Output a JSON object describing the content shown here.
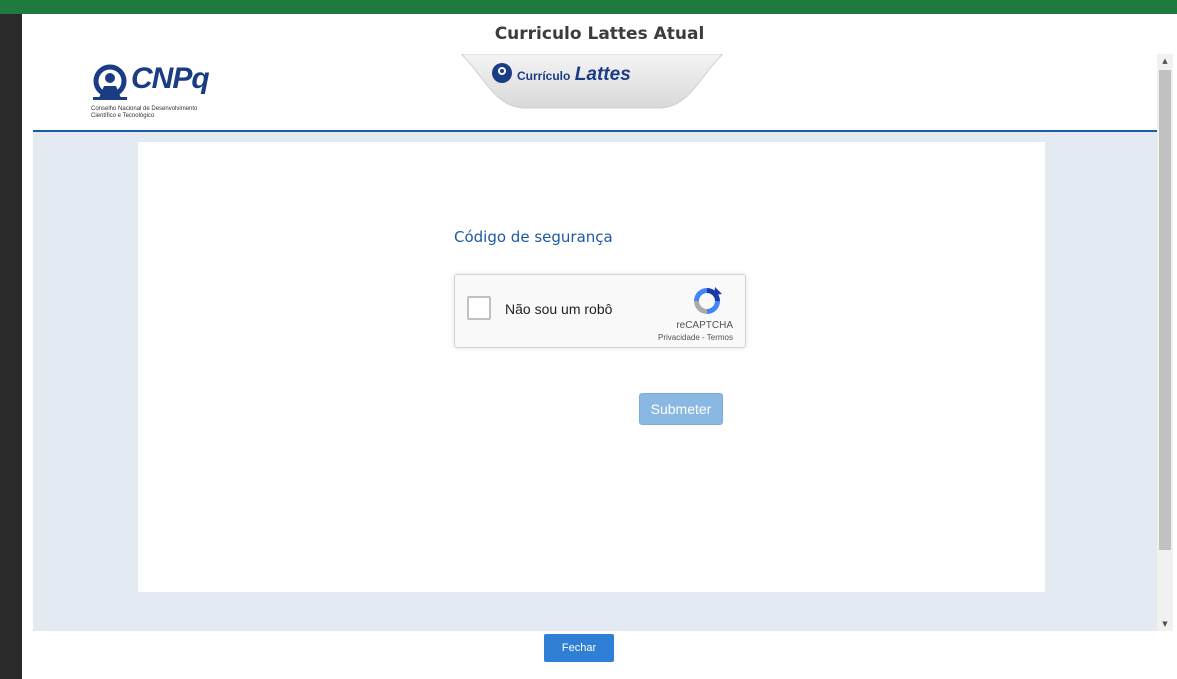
{
  "modal": {
    "title": "Curriculo Lattes Atual"
  },
  "header": {
    "cnpq_logo": "CNPq",
    "cnpq_subtitle_line1": "Conselho Nacional de Desenvolvimento",
    "cnpq_subtitle_line2": "Científico e Tecnológico",
    "lattes_small": "Currículo",
    "lattes_big": "Lattes"
  },
  "form": {
    "security_title": "Código de segurança",
    "recaptcha": {
      "checkbox_label": "Não sou um robô",
      "brand": "reCAPTCHA",
      "privacy": "Privacidade",
      "separator": " - ",
      "terms": "Termos",
      "icon": "recaptcha-icon"
    },
    "submit_label": "Submeter"
  },
  "footer": {
    "close_label": "Fechar"
  },
  "colors": {
    "accent": "#1e5aa0",
    "submit_disabled": "#8ab8e3",
    "close_button": "#2f7fd6",
    "frame_bg": "#e4eaf2"
  }
}
